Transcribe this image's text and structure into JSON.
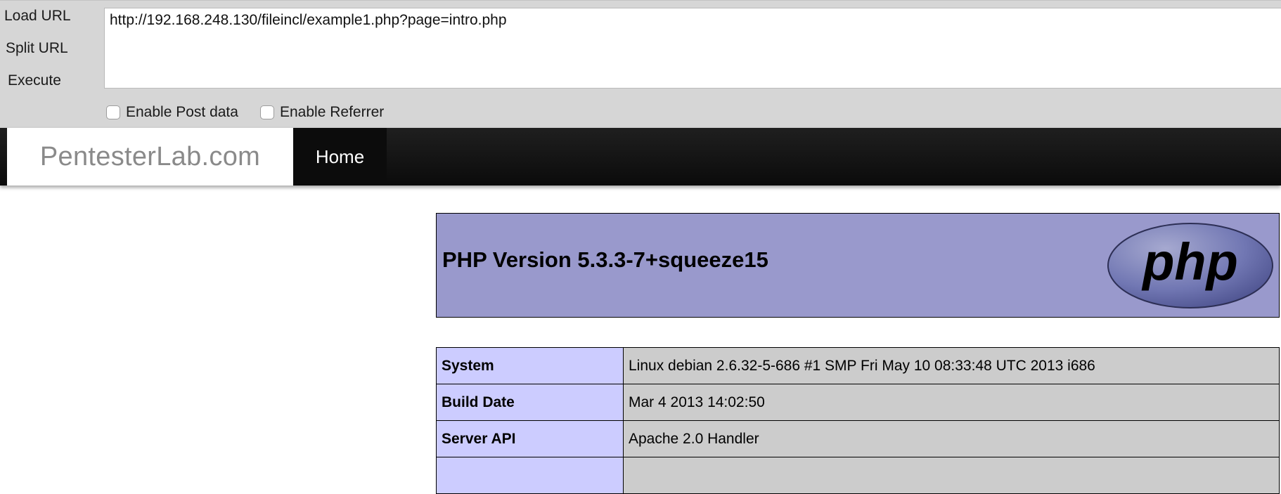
{
  "hackbar": {
    "actions": {
      "load": "Load URL",
      "split": "Split URL",
      "execute": "Execute"
    },
    "url": "http://192.168.248.130/fileincl/example1.php?page=intro.php",
    "options": {
      "post_data": "Enable Post data",
      "referrer": "Enable Referrer"
    }
  },
  "navbar": {
    "brand": "PentesterLab.com",
    "home": "Home"
  },
  "phpinfo": {
    "title": "PHP Version 5.3.3-7+squeeze15",
    "logo_text": "php",
    "rows": [
      {
        "key": "System",
        "value": "Linux debian 2.6.32-5-686 #1 SMP Fri May 10 08:33:48 UTC 2013 i686"
      },
      {
        "key": "Build Date",
        "value": "Mar 4 2013 14:02:50"
      },
      {
        "key": "Server API",
        "value": "Apache 2.0 Handler"
      },
      {
        "key": "",
        "value": ""
      }
    ]
  },
  "colors": {
    "header_bg": "#9999cc",
    "key_bg": "#ccccff",
    "value_bg": "#cccccc",
    "navbar_bg": "#111111",
    "toolbar_bg": "#d6d6d6"
  }
}
